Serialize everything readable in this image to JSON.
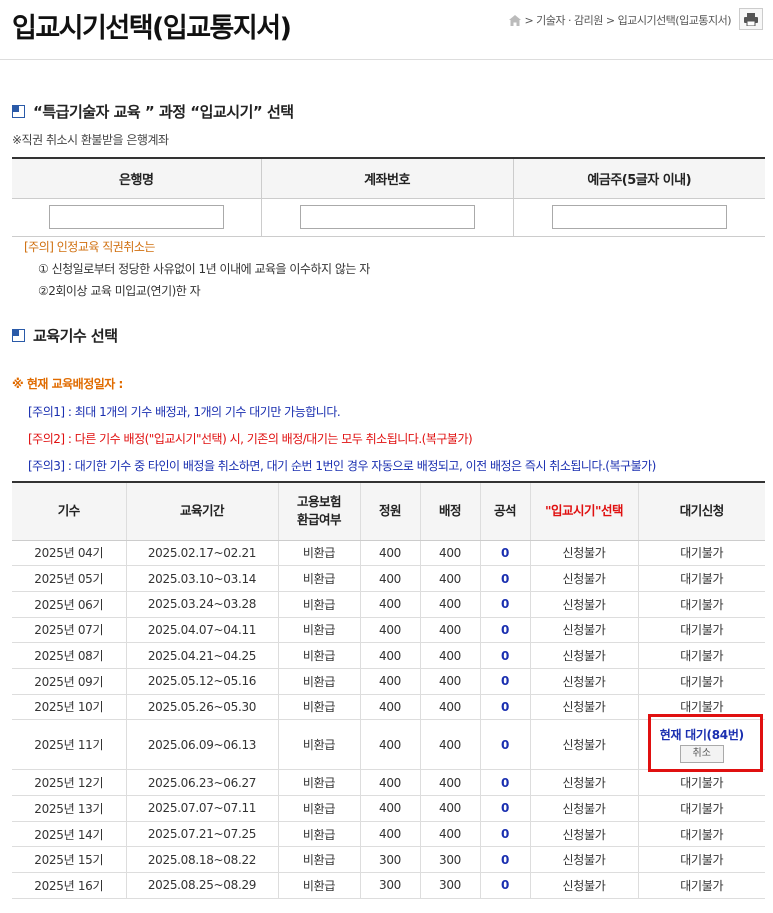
{
  "page": {
    "title": "입교시기선택(입교통지서)",
    "breadcrumb": "> 기술자 · 감리원 > 입교시기선택(입교통지서)"
  },
  "section1": {
    "title": "“특급기술자 교육 ” 과정 “입교시기” 선택",
    "note": "※직권 취소시 환불받을 은행계좌",
    "headers": [
      "은행명",
      "계좌번호",
      "예금주(5글자 이내)"
    ],
    "inputs": [
      {
        "value": "",
        "placeholder": ""
      },
      {
        "value": "",
        "placeholder": ""
      },
      {
        "value": "",
        "placeholder": ""
      }
    ],
    "caution_title": "[주의] 인정교육 직권취소는",
    "caution_items": [
      "① 신청일로부터 정당한 사유없이 1년 이내에 교육을 이수하지 않는 자",
      "②2회이상 교육 미입교(연기)한 자"
    ]
  },
  "section2": {
    "title": "교육기수 선택",
    "current_note": "※ 현재 교육배정일자 :",
    "notice1": "[주의1] : 최대 1개의 기수 배정과, 1개의 기수 대기만 가능합니다.",
    "notice2": "[주의2] : 다른 기수 배정(\"입교시기\"선택) 시, 기존의 배정/대기는 모두 취소됩니다.(복구불가)",
    "notice3": "[주의3] : 대기한 기수 중 타인이 배정을 취소하면, 대기 순번 1번인 경우 자동으로 배정되고, 이전 배정은 즉시 취소됩니다.(복구불가)"
  },
  "table": {
    "headers": {
      "term": "기수",
      "period": "교육기간",
      "insurance_1": "고용보험",
      "insurance_2": "환급여부",
      "capacity": "정원",
      "assigned": "배정",
      "vacancy": "공석",
      "select": "\"입교시기\"선택",
      "waitlist": "대기신청"
    },
    "rows": [
      {
        "term": "2025년 04기",
        "period": "2025.02.17~02.21",
        "insurance": "비환급",
        "capacity": "400",
        "assigned": "400",
        "vacancy": "0",
        "select": "신청불가",
        "wait": "대기불가"
      },
      {
        "term": "2025년 05기",
        "period": "2025.03.10~03.14",
        "insurance": "비환급",
        "capacity": "400",
        "assigned": "400",
        "vacancy": "0",
        "select": "신청불가",
        "wait": "대기불가"
      },
      {
        "term": "2025년 06기",
        "period": "2025.03.24~03.28",
        "insurance": "비환급",
        "capacity": "400",
        "assigned": "400",
        "vacancy": "0",
        "select": "신청불가",
        "wait": "대기불가"
      },
      {
        "term": "2025년 07기",
        "period": "2025.04.07~04.11",
        "insurance": "비환급",
        "capacity": "400",
        "assigned": "400",
        "vacancy": "0",
        "select": "신청불가",
        "wait": "대기불가"
      },
      {
        "term": "2025년 08기",
        "period": "2025.04.21~04.25",
        "insurance": "비환급",
        "capacity": "400",
        "assigned": "400",
        "vacancy": "0",
        "select": "신청불가",
        "wait": "대기불가"
      },
      {
        "term": "2025년 09기",
        "period": "2025.05.12~05.16",
        "insurance": "비환급",
        "capacity": "400",
        "assigned": "400",
        "vacancy": "0",
        "select": "신청불가",
        "wait": "대기불가"
      },
      {
        "term": "2025년 10기",
        "period": "2025.05.26~05.30",
        "insurance": "비환급",
        "capacity": "400",
        "assigned": "400",
        "vacancy": "0",
        "select": "신청불가",
        "wait": "대기불가"
      },
      {
        "term": "2025년 11기",
        "period": "2025.06.09~06.13",
        "insurance": "비환급",
        "capacity": "400",
        "assigned": "400",
        "vacancy": "0",
        "select": "신청불가",
        "wait_current": "현재 대기(84번)",
        "wait_cancel": "취소"
      },
      {
        "term": "2025년 12기",
        "period": "2025.06.23~06.27",
        "insurance": "비환급",
        "capacity": "400",
        "assigned": "400",
        "vacancy": "0",
        "select": "신청불가",
        "wait": "대기불가"
      },
      {
        "term": "2025년 13기",
        "period": "2025.07.07~07.11",
        "insurance": "비환급",
        "capacity": "400",
        "assigned": "400",
        "vacancy": "0",
        "select": "신청불가",
        "wait": "대기불가"
      },
      {
        "term": "2025년 14기",
        "period": "2025.07.21~07.25",
        "insurance": "비환급",
        "capacity": "400",
        "assigned": "400",
        "vacancy": "0",
        "select": "신청불가",
        "wait": "대기불가"
      },
      {
        "term": "2025년 15기",
        "period": "2025.08.18~08.22",
        "insurance": "비환급",
        "capacity": "300",
        "assigned": "300",
        "vacancy": "0",
        "select": "신청불가",
        "wait": "대기불가"
      },
      {
        "term": "2025년 16기",
        "period": "2025.08.25~08.29",
        "insurance": "비환급",
        "capacity": "300",
        "assigned": "300",
        "vacancy": "0",
        "select": "신청불가",
        "wait": "대기불가"
      }
    ]
  },
  "colors": {
    "notice_blue": "#1a2fb0",
    "notice_red": "#e01010",
    "notice_orange": "#e06b00",
    "highlight_border": "#e01010"
  }
}
